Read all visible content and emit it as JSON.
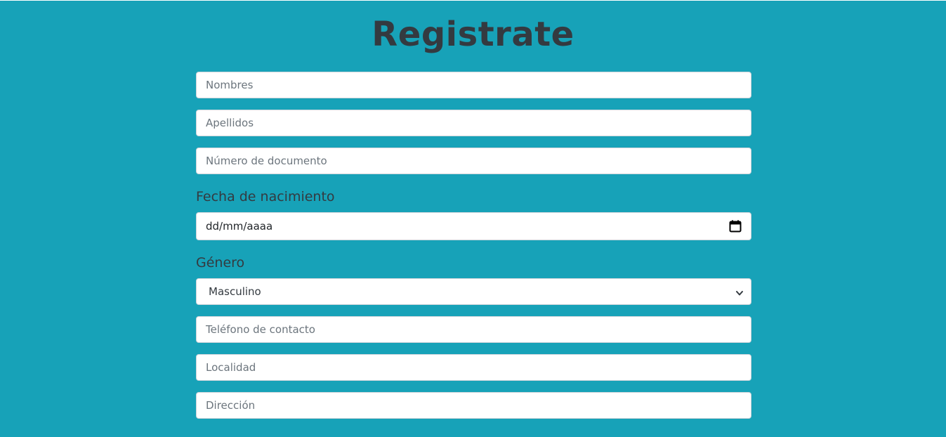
{
  "header": {
    "title": "Registrate"
  },
  "form": {
    "nombres_placeholder": "Nombres",
    "apellidos_placeholder": "Apellidos",
    "documento_placeholder": "Número de documento",
    "fecha_label": "Fecha de nacimiento",
    "fecha_placeholder": "dd/mm/aaaa",
    "fecha_icon": "calendar-icon",
    "genero_label": "Género",
    "genero_selected": "Masculino",
    "genero_icon": "chevron-down-icon",
    "telefono_placeholder": "Teléfono de contacto",
    "localidad_placeholder": "Localidad",
    "direccion_placeholder": "Dirección"
  },
  "colors": {
    "background": "#17a2b8",
    "title": "#343a40",
    "input_bg": "#ffffff",
    "placeholder": "#6c757d"
  }
}
